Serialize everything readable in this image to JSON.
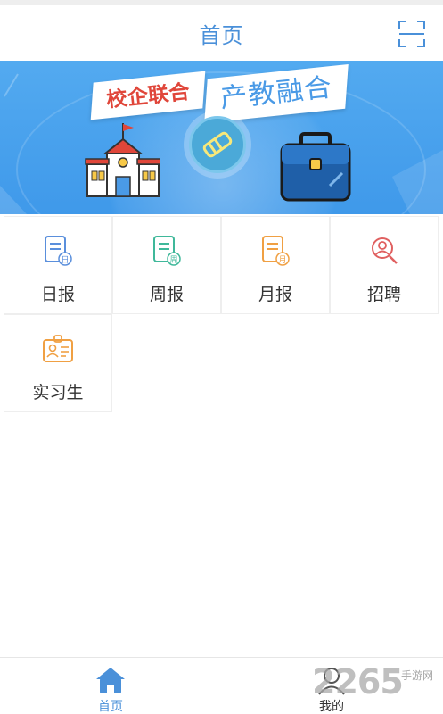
{
  "header": {
    "title": "首页",
    "scan_icon": "scan-icon"
  },
  "banner": {
    "tag_left": "校企联合",
    "tag_right": "产教融合",
    "icons": [
      "school-icon",
      "handshake-icon",
      "briefcase-icon"
    ]
  },
  "grid": {
    "items": [
      {
        "label": "日报",
        "icon": "daily-report-icon",
        "badge": "日",
        "color": "#5a8fdc"
      },
      {
        "label": "周报",
        "icon": "weekly-report-icon",
        "badge": "周",
        "color": "#3fb89a"
      },
      {
        "label": "月报",
        "icon": "monthly-report-icon",
        "badge": "月",
        "color": "#f0a043"
      },
      {
        "label": "招聘",
        "icon": "recruit-search-icon",
        "color": "#e06060"
      },
      {
        "label": "实习生",
        "icon": "intern-badge-icon",
        "color": "#f0a043"
      }
    ]
  },
  "tabbar": {
    "tabs": [
      {
        "label": "首页",
        "icon": "home-icon",
        "active": true,
        "color": "#4a90d9"
      },
      {
        "label": "我的",
        "icon": "user-icon",
        "active": false,
        "color": "#333333"
      }
    ]
  },
  "watermark": {
    "brand": "2265",
    "sub": "手游网"
  }
}
